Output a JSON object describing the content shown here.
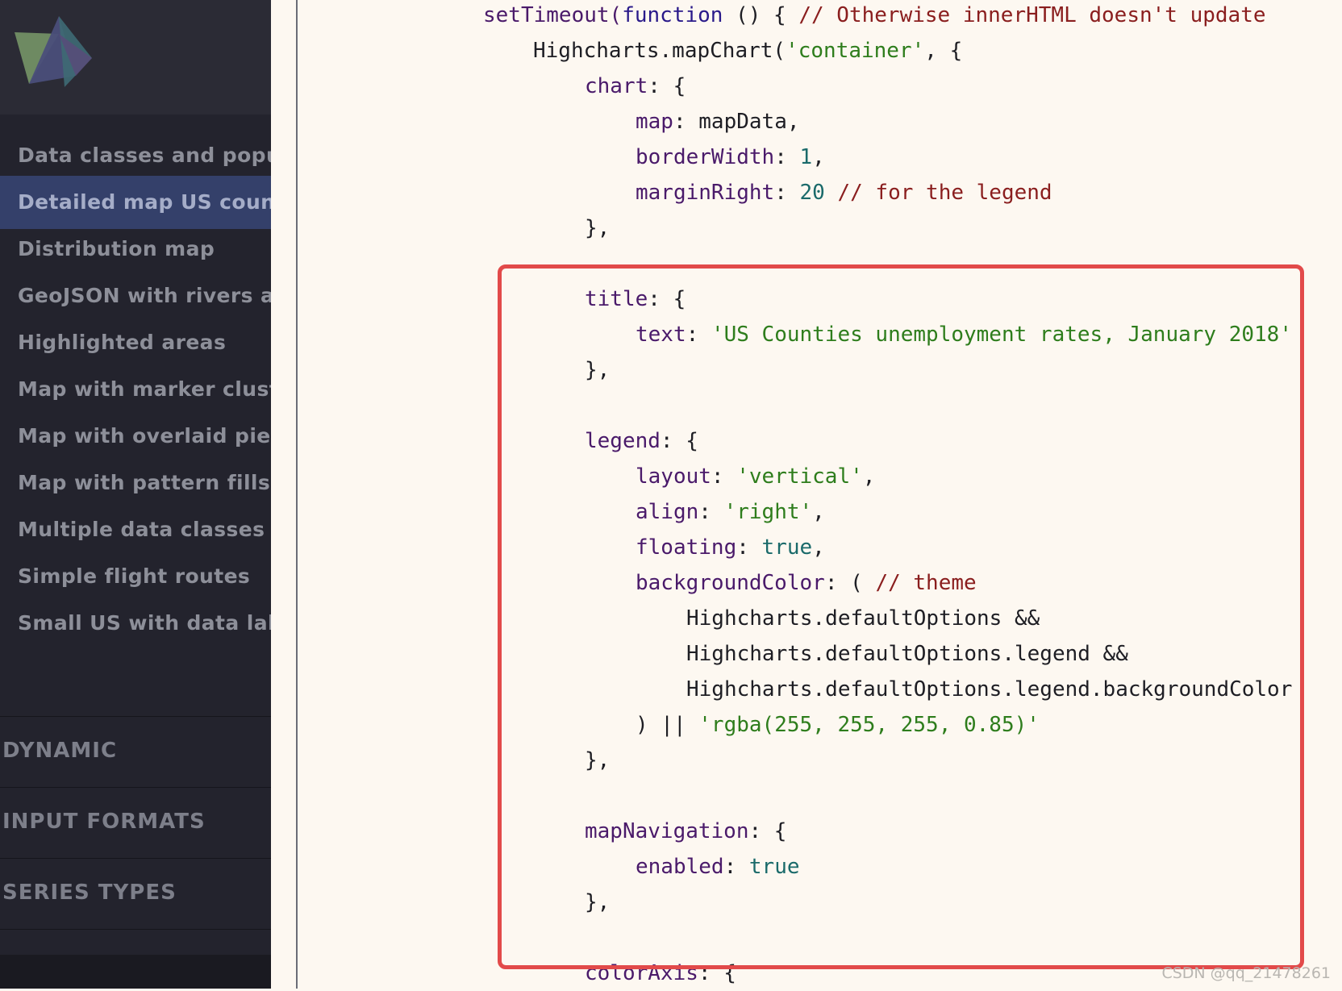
{
  "sidebar": {
    "logo_icon": "highcharts-logo-icon",
    "items": [
      {
        "label": "Data classes and popup",
        "active": false
      },
      {
        "label": "Detailed map US counties",
        "active": true
      },
      {
        "label": "Distribution map",
        "active": false
      },
      {
        "label": "GeoJSON with rivers and cities",
        "active": false
      },
      {
        "label": "Highlighted areas",
        "active": false
      },
      {
        "label": "Map with marker clusters",
        "active": false
      },
      {
        "label": "Map with overlaid pie charts",
        "active": false
      },
      {
        "label": "Map with pattern fills",
        "active": false
      },
      {
        "label": "Multiple data classes",
        "active": false
      },
      {
        "label": "Simple flight routes",
        "active": false
      },
      {
        "label": "Small US with data labels",
        "active": false
      }
    ],
    "sections": [
      {
        "label": "DYNAMIC"
      },
      {
        "label": "INPUT FORMATS"
      },
      {
        "label": "SERIES TYPES"
      }
    ]
  },
  "code": {
    "l1": {
      "a": "setTimeout(",
      "b": "function",
      "c": " () { ",
      "d": "// Otherwise innerHTML doesn't update"
    },
    "l2": {
      "a": "Highcharts.mapChart(",
      "b": "'container'",
      "c": ", {"
    },
    "l3": {
      "a": "chart",
      "b": ": {"
    },
    "l4": {
      "a": "map",
      "b": ": mapData,"
    },
    "l5": {
      "a": "borderWidth",
      "b": ": ",
      "c": "1",
      "d": ","
    },
    "l6": {
      "a": "marginRight",
      "b": ": ",
      "c": "20",
      "d": " ",
      "e": "// for the legend"
    },
    "l7": "},",
    "l8": {
      "a": "title",
      "b": ": {"
    },
    "l9": {
      "a": "text",
      "b": ": ",
      "c": "'US Counties unemployment rates, January 2018'"
    },
    "l10": "},",
    "l11": {
      "a": "legend",
      "b": ": {"
    },
    "l12": {
      "a": "layout",
      "b": ": ",
      "c": "'vertical'",
      "d": ","
    },
    "l13": {
      "a": "align",
      "b": ": ",
      "c": "'right'",
      "d": ","
    },
    "l14": {
      "a": "floating",
      "b": ": ",
      "c": "true",
      "d": ","
    },
    "l15": {
      "a": "backgroundColor",
      "b": ": ( ",
      "c": "// theme"
    },
    "l16": "Highcharts.defaultOptions &&",
    "l17": "Highcharts.defaultOptions.legend &&",
    "l18": "Highcharts.defaultOptions.legend.backgroundColor",
    "l19": {
      "a": ") || ",
      "b": "'rgba(255, 255, 255, 0.85)'"
    },
    "l20": "},",
    "l21": {
      "a": "mapNavigation",
      "b": ": {"
    },
    "l22": {
      "a": "enabled",
      "b": ": ",
      "c": "true"
    },
    "l23": "},",
    "l24": {
      "a": "colorAxis",
      "b": ": {"
    }
  },
  "watermark": "CSDN @qq_21478261",
  "colors": {
    "highlight": "#e24a4a",
    "active_nav": "#34406a",
    "sidebar_bg": "#23232d",
    "code_bg": "#fdf8f1"
  }
}
